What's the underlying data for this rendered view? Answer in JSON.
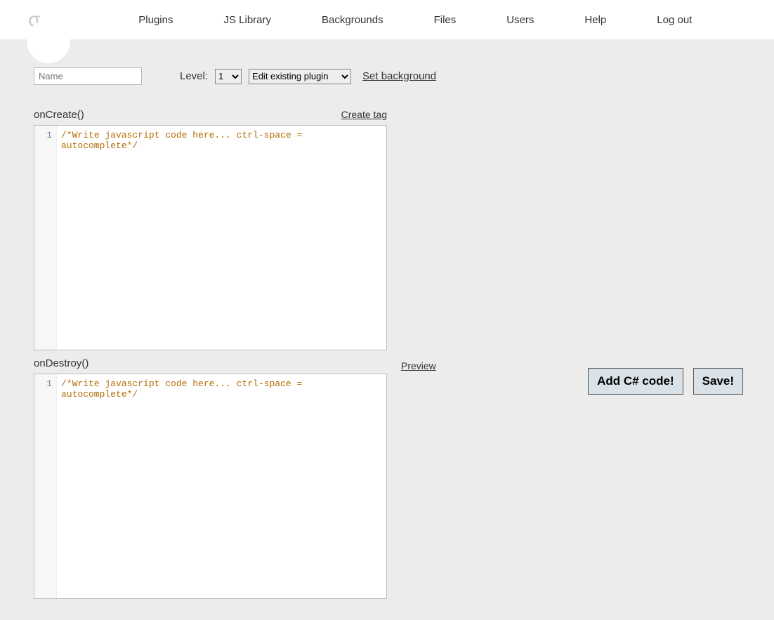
{
  "logo": "σ",
  "nav": {
    "plugins": "Plugins",
    "jslibrary": "JS Library",
    "backgrounds": "Backgrounds",
    "files": "Files",
    "users": "Users",
    "help": "Help",
    "logout": "Log out"
  },
  "form": {
    "name_placeholder": "Name",
    "name_value": "",
    "level_label": "Level:",
    "level_selected": "1",
    "plugin_mode_selected": "Edit existing plugin",
    "set_background": "Set background"
  },
  "editor1": {
    "label": "onCreate()",
    "right_link": "Create tag",
    "line_number": "1",
    "placeholder_code": "/*Write javascript code here... ctrl-space = autocomplete*/"
  },
  "editor2": {
    "label": "onDestroy()",
    "right_link": "Preview",
    "line_number": "1",
    "placeholder_code": "/*Write javascript code here... ctrl-space = autocomplete*/"
  },
  "buttons": {
    "add_csharp": "Add C# code!",
    "save": "Save!"
  }
}
